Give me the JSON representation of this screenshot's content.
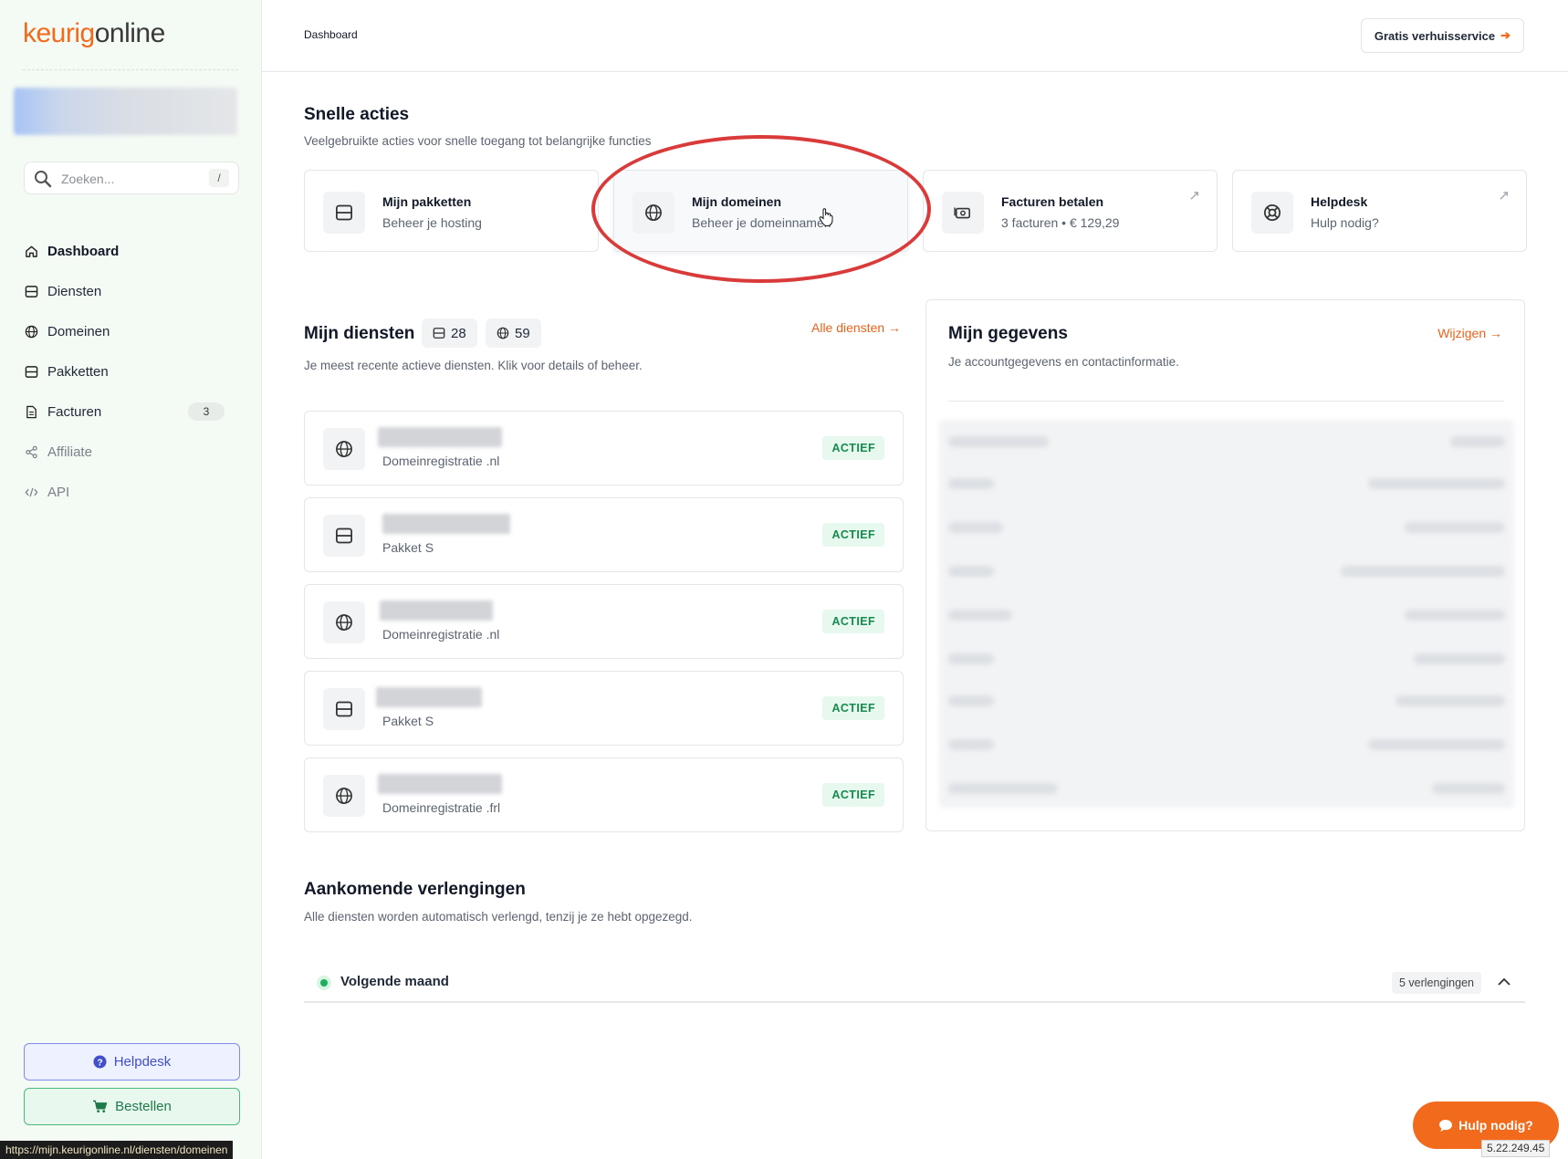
{
  "brand": {
    "part1": "keurig",
    "part2": "online",
    "primary": "#f26a1b"
  },
  "search": {
    "placeholder": "Zoeken...",
    "shortcut": "/"
  },
  "sidebar": {
    "items": [
      {
        "label": "Dashboard",
        "icon": "home-icon"
      },
      {
        "label": "Diensten",
        "icon": "server-icon"
      },
      {
        "label": "Domeinen",
        "icon": "globe-icon"
      },
      {
        "label": "Pakketten",
        "icon": "server-icon"
      },
      {
        "label": "Facturen",
        "icon": "document-icon",
        "badge": "3"
      },
      {
        "label": "Affiliate",
        "icon": "share-icon"
      },
      {
        "label": "API",
        "icon": "code-icon"
      }
    ],
    "helpdesk_label": "Helpdesk",
    "order_label": "Bestellen"
  },
  "status_url": "https://mijn.keurigonline.nl/diensten/domeinen",
  "header": {
    "breadcrumb": "Dashboard",
    "move_button": "Gratis verhuisservice"
  },
  "quick": {
    "title": "Snelle acties",
    "subtitle": "Veelgebruikte acties voor snelle toegang tot belangrijke functies",
    "cards": [
      {
        "title": "Mijn pakketten",
        "sub": "Beheer je hosting"
      },
      {
        "title": "Mijn domeinen",
        "sub": "Beheer je domeinnamen"
      },
      {
        "title": "Facturen betalen",
        "sub": "3 facturen • € 129,29"
      },
      {
        "title": "Helpdesk",
        "sub": "Hulp nodig?"
      }
    ]
  },
  "services": {
    "title": "Mijn diensten",
    "packages_count": "28",
    "domains_count": "59",
    "all_link": "Alle diensten →",
    "subtitle": "Je meest recente actieve diensten. Klik voor details of beheer.",
    "items": [
      {
        "type": "Domeinregistratie .nl",
        "status": "ACTIEF",
        "icon": "globe-icon"
      },
      {
        "type": "Pakket S",
        "status": "ACTIEF",
        "icon": "server-icon"
      },
      {
        "type": "Domeinregistratie .nl",
        "status": "ACTIEF",
        "icon": "globe-icon"
      },
      {
        "type": "Pakket S",
        "status": "ACTIEF",
        "icon": "server-icon"
      },
      {
        "type": "Domeinregistratie .frl",
        "status": "ACTIEF",
        "icon": "globe-icon"
      }
    ]
  },
  "gegevens": {
    "title": "Mijn gegevens",
    "edit_link": "Wijzigen →",
    "subtitle": "Je accountgegevens en contactinformatie."
  },
  "renewals": {
    "title": "Aankomende verlengingen",
    "subtitle": "Alle diensten worden automatisch verlengd, tenzij je ze hebt opgezegd.",
    "group_label": "Volgende maand",
    "group_count": "5 verlengingen"
  },
  "help_fab": "Hulp nodig?",
  "ip_address": "5.22.249.45"
}
